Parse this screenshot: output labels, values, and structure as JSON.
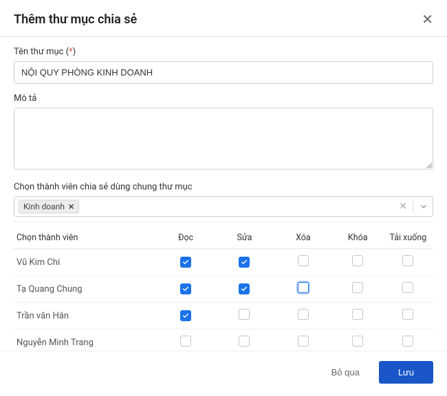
{
  "header": {
    "title": "Thêm thư mục chia sẻ"
  },
  "fields": {
    "folderName": {
      "label": "Tên thư mục (",
      "asterisk": "*",
      "labelClose": ")",
      "value": "NỘI QUY PHÒNG KINH DOANH"
    },
    "description": {
      "label": "Mô tả",
      "value": ""
    },
    "members": {
      "label": "Chọn thành viên chia sẻ dùng chung thư mục",
      "tag": "Kinh doanh"
    }
  },
  "table": {
    "headers": {
      "member": "Chọn thành viên",
      "read": "Đọc",
      "edit": "Sửa",
      "delete": "Xóa",
      "lock": "Khóa",
      "download": "Tải xuống"
    },
    "rows": [
      {
        "name": "Vũ Kim Chi",
        "read": true,
        "edit": true,
        "delete": false,
        "lock": false,
        "download": false,
        "focus": ""
      },
      {
        "name": "Tạ Quang Chung",
        "read": true,
        "edit": true,
        "delete": false,
        "lock": false,
        "download": false,
        "focus": "delete"
      },
      {
        "name": "Trần văn Hân",
        "read": true,
        "edit": false,
        "delete": false,
        "lock": false,
        "download": false,
        "focus": ""
      },
      {
        "name": "Nguyễn Minh Trang",
        "read": false,
        "edit": false,
        "delete": false,
        "lock": false,
        "download": false,
        "focus": ""
      }
    ]
  },
  "footer": {
    "skip": "Bỏ qua",
    "save": "Lưu"
  }
}
